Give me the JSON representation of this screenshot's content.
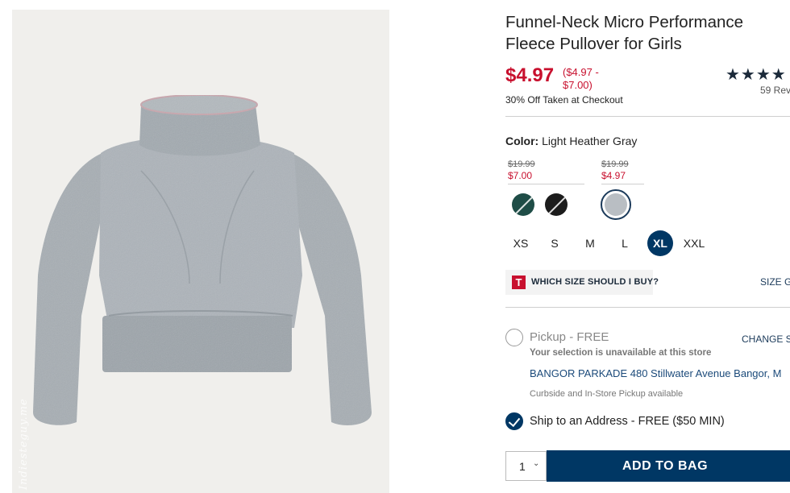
{
  "product": {
    "title": "Funnel-Neck Micro Performance Fleece Pullover for Girls",
    "price": "$4.97",
    "price_range": "($4.97 - $7.00)",
    "price_note": "30% Off Taken at Checkout",
    "stars": "★★★★",
    "rating_stars_shown": 4,
    "reviews": "59 Rev"
  },
  "image": {
    "watermark": "Indiesteguy.me",
    "garment_color": "#a9b0b6"
  },
  "color": {
    "label": "Color:",
    "value": "Light Heather Gray",
    "groups": [
      {
        "original": "$19.99",
        "sale": "$7.00",
        "swatches": [
          {
            "name": "green",
            "color": "#1f4d47"
          },
          {
            "name": "black",
            "color": "#1c1c1c"
          }
        ]
      },
      {
        "original": "$19.99",
        "sale": "$4.97",
        "swatches": [
          {
            "name": "light-heather-gray",
            "color": "#b9bec3",
            "selected": true
          }
        ]
      }
    ]
  },
  "sizes": {
    "options": [
      "XS",
      "S",
      "M",
      "L",
      "XL",
      "XXL"
    ],
    "selected": "XL"
  },
  "fit": {
    "icon": "T",
    "label": "WHICH SIZE SHOULD I BUY?",
    "size_guide": "SIZE GU"
  },
  "fulfillment": {
    "pickup_label": "Pickup - FREE",
    "change_store": "CHANGE ST",
    "unavailable": "Your selection is unavailable at this store",
    "store_name": "BANGOR PARKADE",
    "store_address": "480 Stillwater Avenue",
    "store_city": "Bangor, M",
    "curbside": "Curbside and In-Store Pickup available",
    "ship_label": "Ship to an Address - FREE ($50 MIN)"
  },
  "cart": {
    "quantity": "1",
    "add_label": "ADD TO BAG"
  },
  "colors": {
    "brand_navy": "#003764",
    "sale_red": "#c8102e"
  }
}
